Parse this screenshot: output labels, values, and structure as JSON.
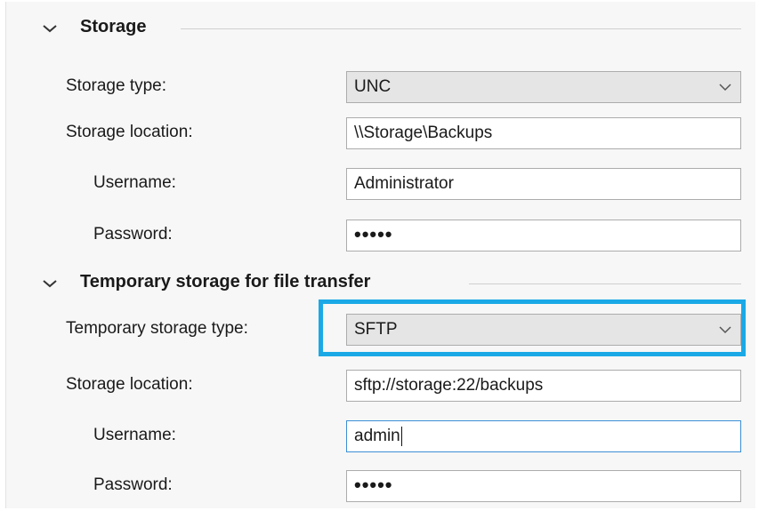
{
  "storage_section": {
    "title": "Storage",
    "storage_type_label": "Storage type:",
    "storage_type_value": "UNC",
    "location_label": "Storage location:",
    "location_value": "\\\\Storage\\Backups",
    "username_label": "Username:",
    "username_value": "Administrator",
    "password_label": "Password:",
    "password_value": "•••••"
  },
  "temp_section": {
    "title": "Temporary storage for file transfer",
    "storage_type_label": "Temporary storage type:",
    "storage_type_value": "SFTP",
    "location_label": "Storage location:",
    "location_value": "sftp://storage:22/backups",
    "username_label": "Username:",
    "username_value": "admin",
    "password_label": "Password:",
    "password_value": "•••••"
  },
  "icons": {
    "collapse": "chevron-down-icon",
    "dropdown": "chevron-down-icon"
  },
  "colors": {
    "highlight": "#1aa9e6",
    "focus_border": "#3b8fd6",
    "select_bg": "#e5e5e5"
  }
}
